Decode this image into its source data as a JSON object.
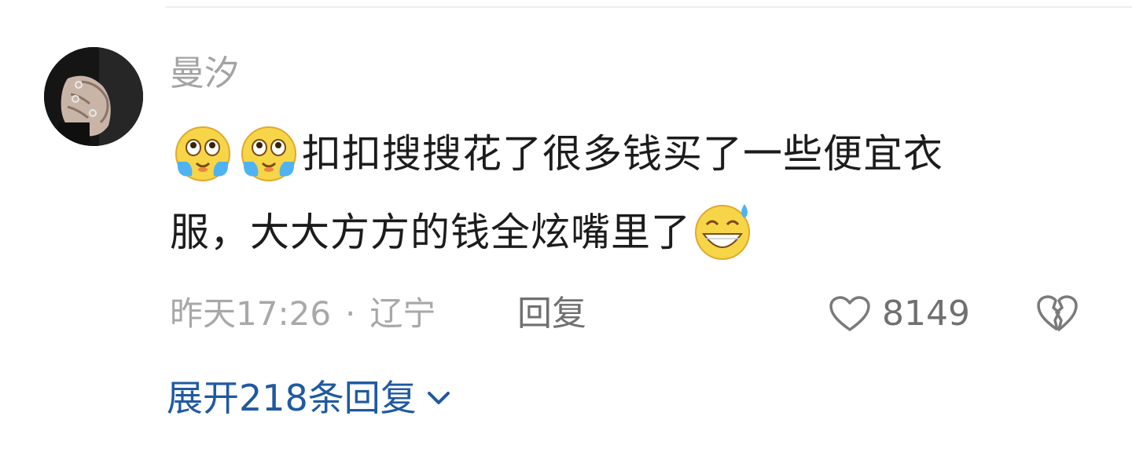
{
  "comment": {
    "username": "曼汐",
    "text_line1_emojis": [
      "crying-laughing-emoji",
      "crying-laughing-emoji"
    ],
    "text_line1": "扣扣搜搜花了很多钱买了一些便宜衣",
    "text_line2": "服，大大方方的钱全炫嘴里了",
    "text_line2_emoji": "grin-sweat-emoji",
    "time": "昨天17:26",
    "separator": "·",
    "location": "辽宁",
    "reply_label": "回复",
    "like_count": "8149",
    "expand_label": "展开218条回复"
  },
  "colors": {
    "username": "#a3a3a3",
    "text": "#1c1c1c",
    "meta": "#a8a8a8",
    "action": "#707070",
    "link": "#1f5aa0"
  },
  "icons": {
    "like": "heart-outline-icon",
    "dislike": "broken-heart-icon",
    "expand": "chevron-down-icon"
  }
}
